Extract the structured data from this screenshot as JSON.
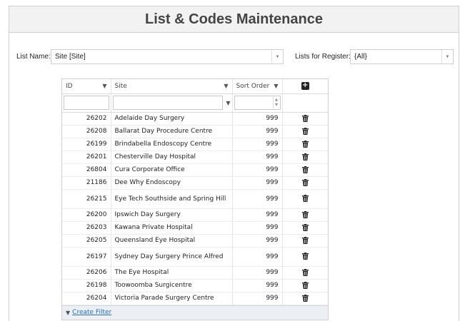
{
  "page": {
    "title": "List & Codes Maintenance"
  },
  "filters": {
    "list_name_label": "List Name:",
    "list_name_value": "Site   [Site]",
    "lists_for_register_label": "Lists for Register:",
    "lists_for_register_value": "{All}"
  },
  "grid": {
    "columns": {
      "id": "ID",
      "site": "Site",
      "sort_order": "Sort Order"
    },
    "rows": [
      {
        "id": "26202",
        "site": "Adelaide Day Surgery",
        "sort_order": "999"
      },
      {
        "id": "26208",
        "site": "Ballarat Day Procedure Centre",
        "sort_order": "999"
      },
      {
        "id": "26199",
        "site": "Brindabella Endoscopy Centre",
        "sort_order": "999"
      },
      {
        "id": "26201",
        "site": "Chesterville Day Hospital",
        "sort_order": "999"
      },
      {
        "id": "26804",
        "site": "Cura Corporate Office",
        "sort_order": "999"
      },
      {
        "id": "21186",
        "site": "Dee Why Endoscopy",
        "sort_order": "999"
      },
      {
        "id": "26215",
        "site": "Eye Tech Southside and Spring Hill",
        "sort_order": "999"
      },
      {
        "id": "26200",
        "site": "Ipswich Day Surgery",
        "sort_order": "999"
      },
      {
        "id": "26203",
        "site": "Kawana Private Hospital",
        "sort_order": "999"
      },
      {
        "id": "26205",
        "site": "Queensland Eye Hospital",
        "sort_order": "999"
      },
      {
        "id": "26197",
        "site": "Sydney Day Surgery Prince Alfred",
        "sort_order": "999"
      },
      {
        "id": "26206",
        "site": "The Eye Hospital",
        "sort_order": "999"
      },
      {
        "id": "26198",
        "site": "Toowoomba Surgicentre",
        "sort_order": "999"
      },
      {
        "id": "26204",
        "site": "Victoria Parade Surgery Centre",
        "sort_order": "999"
      }
    ],
    "footer_link": "Create Filter"
  },
  "icons": {
    "filter": "funnel-icon",
    "add": "plus-square-icon",
    "delete": "trash-icon",
    "dropdown": "chevron-down-icon"
  }
}
